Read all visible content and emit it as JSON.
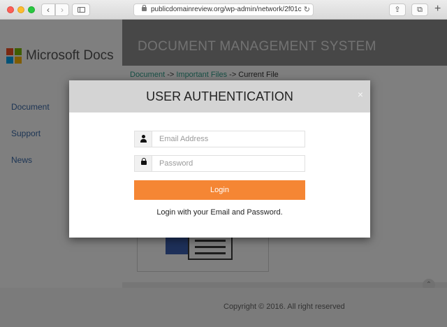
{
  "browser": {
    "url": "publicdomainreview.org/wp-admin/network/2f01c"
  },
  "page": {
    "logo_text": "Microsoft Docs",
    "header_title": "DOCUMENT MANAGEMENT SYSTEM",
    "breadcrumb": {
      "item1": "Document",
      "sep1": " -> ",
      "item2": "Important Files",
      "sep2": " -> ",
      "item3": "Current File"
    },
    "side_nav": [
      "Document",
      "Support",
      "News"
    ],
    "copyright": "Copyright © 2016. All right reserved"
  },
  "modal": {
    "title": "USER AUTHENTICATION",
    "close_label": "×",
    "email_placeholder": "Email Address",
    "password_placeholder": "Password",
    "login_label": "Login",
    "helper_text": "Login with your Email and Password."
  },
  "colors": {
    "accent": "#f58634",
    "header_bg": "#8f8f8f",
    "link": "#2e9e8a",
    "nav_link": "#3b6aa9"
  },
  "icons": [
    "lock-icon",
    "reload-icon",
    "share-icon",
    "tabs-icon",
    "user-icon",
    "password-lock-icon"
  ]
}
